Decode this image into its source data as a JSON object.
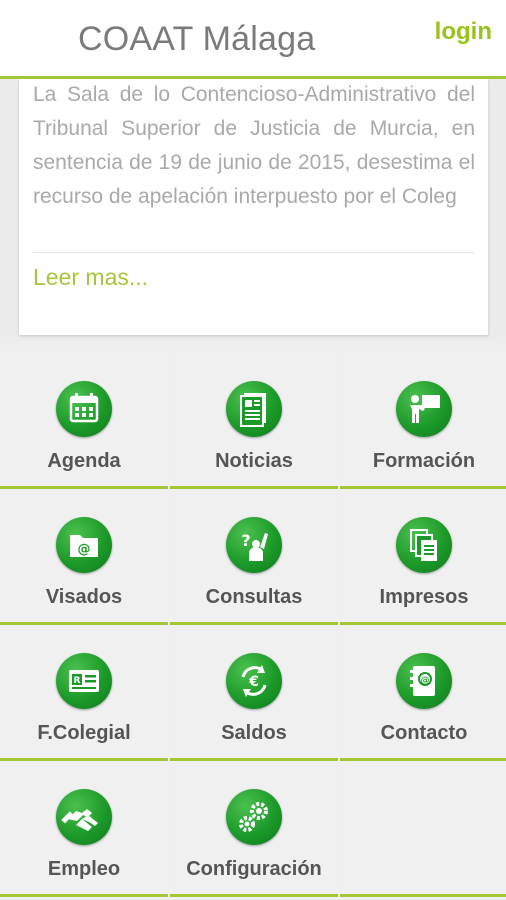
{
  "header": {
    "title": "COAAT Málaga",
    "login_label": "login"
  },
  "news": {
    "text": "La Sala de lo Contencioso-Administrativo del Tribunal Superior de Justicia de Murcia, en sentencia de 19 de junio de 2015, desestima el recurso de apelación interpuesto por el Coleg",
    "more_label": "Leer mas..."
  },
  "menu": {
    "agenda": "Agenda",
    "noticias": "Noticias",
    "formacion": "Formación",
    "visados": "Visados",
    "consultas": "Consultas",
    "impresos": "Impresos",
    "fcolegial": "F.Colegial",
    "saldos": "Saldos",
    "contacto": "Contacto",
    "empleo": "Empleo",
    "configuracion": "Configuración"
  },
  "colors": {
    "accent": "#a3c633",
    "icon_green": "#1c9a29",
    "login": "#99c31a"
  },
  "icons": [
    "calendar-icon",
    "newspaper-icon",
    "teacher-icon",
    "envelope-at-icon",
    "question-hand-icon",
    "documents-icon",
    "id-card-icon",
    "euro-cycle-icon",
    "address-book-icon",
    "handshake-icon",
    "gears-icon"
  ]
}
